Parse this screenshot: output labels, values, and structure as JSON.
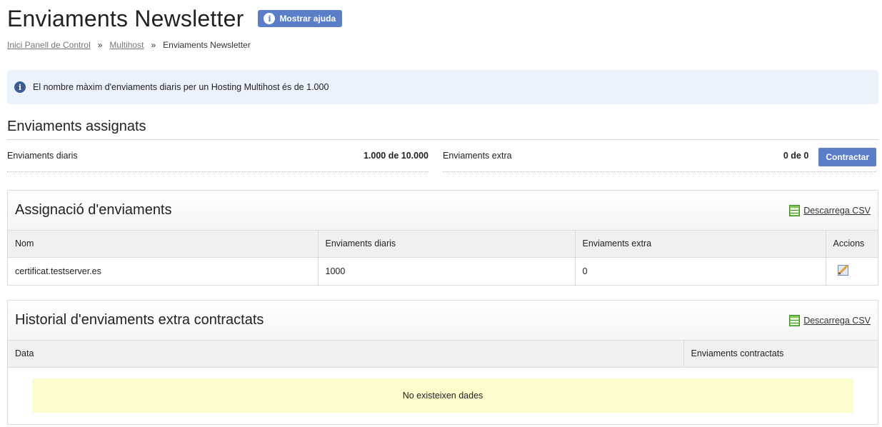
{
  "header": {
    "title": "Enviaments Newsletter",
    "help_button": "Mostrar ajuda"
  },
  "breadcrumb": {
    "items": [
      "Inici Panell de Control",
      "Multihost"
    ],
    "separator": "»",
    "current": "Enviaments Newsletter"
  },
  "info": {
    "message": "El nombre màxim d'enviaments diaris per un Hosting Multihost és de 1.000"
  },
  "assigned": {
    "title": "Enviaments assignats",
    "daily_label": "Enviaments diaris",
    "daily_value": "1.000 de 10.000",
    "extra_label": "Enviaments extra",
    "extra_value": "0 de 0",
    "contract_button": "Contractar"
  },
  "assignment_panel": {
    "title": "Assignació d'enviaments",
    "csv_link": "Descarrega CSV",
    "columns": [
      "Nom",
      "Enviaments diaris",
      "Enviaments extra",
      "Accions"
    ],
    "rows": [
      {
        "name": "certificat.testserver.es",
        "daily": "1000",
        "extra": "0"
      }
    ]
  },
  "history_panel": {
    "title": "Historial d'enviaments extra contractats",
    "csv_link": "Descarrega CSV",
    "columns": [
      "Data",
      "Enviaments contractats"
    ],
    "empty_message": "No existeixen dades"
  },
  "colors": {
    "accent": "#5b7ec9",
    "info_bg": "#ebf2fc",
    "empty_bg": "#fdfccc"
  }
}
